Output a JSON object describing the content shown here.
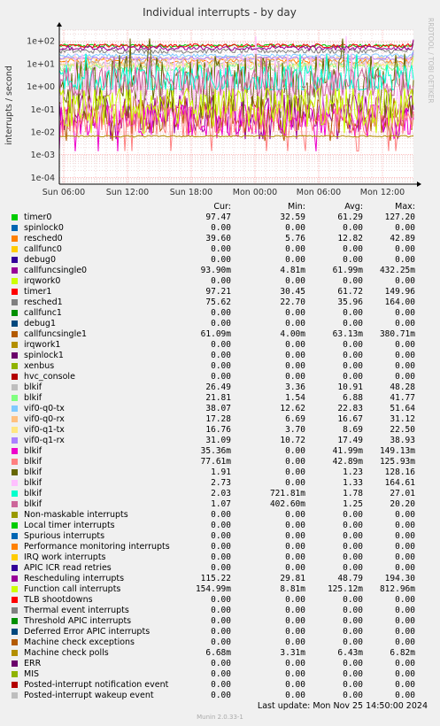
{
  "colors": {
    "background": "#f0f0f0",
    "plot_background": "#ffffff",
    "grid_major": "#ff9999",
    "grid_minor": "#e0b0b0"
  },
  "legend_header": {
    "cur": "Cur:",
    "min": "Min:",
    "avg": "Avg:",
    "max": "Max:"
  },
  "footer": {
    "last_update": "Last update:  Mon Nov 25 14:50:00 2024",
    "munin_version": "Munin 2.0.33-1"
  },
  "chart_data": {
    "type": "line",
    "title": "Individual interrupts - by day",
    "ylabel": "interrupts / second",
    "watermark": "RRDTOOL / TOBI OETIKER",
    "yscale": "log",
    "ylim": [
      5e-05,
      300
    ],
    "y_ticks": [
      {
        "value": 0.0001,
        "label": "1e-04"
      },
      {
        "value": 0.001,
        "label": "1e-03"
      },
      {
        "value": 0.01,
        "label": "1e-02"
      },
      {
        "value": 0.1,
        "label": "1e-01"
      },
      {
        "value": 1,
        "label": "1e+00"
      },
      {
        "value": 10,
        "label": "1e+01"
      },
      {
        "value": 100,
        "label": "1e+02"
      }
    ],
    "x_ticks": [
      "Sun 06:00",
      "Sun 12:00",
      "Sun 18:00",
      "Mon 00:00",
      "Mon 06:00",
      "Mon 12:00"
    ],
    "grid": true,
    "series": [
      {
        "name": "timer0",
        "color": "#00cc00",
        "cur": "97.47",
        "min": "32.59",
        "avg": "61.29",
        "max": "127.20"
      },
      {
        "name": "spinlock0",
        "color": "#0066b3",
        "cur": "0.00",
        "min": "0.00",
        "avg": "0.00",
        "max": "0.00"
      },
      {
        "name": "resched0",
        "color": "#ff8000",
        "cur": "39.60",
        "min": "5.76",
        "avg": "12.82",
        "max": "42.89"
      },
      {
        "name": "callfunc0",
        "color": "#ffcc00",
        "cur": "0.00",
        "min": "0.00",
        "avg": "0.00",
        "max": "0.00"
      },
      {
        "name": "debug0",
        "color": "#330099",
        "cur": "0.00",
        "min": "0.00",
        "avg": "0.00",
        "max": "0.00"
      },
      {
        "name": "callfuncsingle0",
        "color": "#990099",
        "cur": "93.90m",
        "min": "4.81m",
        "avg": "61.99m",
        "max": "432.25m"
      },
      {
        "name": "irqwork0",
        "color": "#ccff00",
        "cur": "0.00",
        "min": "0.00",
        "avg": "0.00",
        "max": "0.00"
      },
      {
        "name": "timer1",
        "color": "#ff0000",
        "cur": "97.21",
        "min": "30.45",
        "avg": "61.72",
        "max": "149.96"
      },
      {
        "name": "resched1",
        "color": "#808080",
        "cur": "75.62",
        "min": "22.70",
        "avg": "35.96",
        "max": "164.00"
      },
      {
        "name": "callfunc1",
        "color": "#008f00",
        "cur": "0.00",
        "min": "0.00",
        "avg": "0.00",
        "max": "0.00"
      },
      {
        "name": "debug1",
        "color": "#00487d",
        "cur": "0.00",
        "min": "0.00",
        "avg": "0.00",
        "max": "0.00"
      },
      {
        "name": "callfuncsingle1",
        "color": "#b35a00",
        "cur": "61.09m",
        "min": "4.00m",
        "avg": "63.13m",
        "max": "380.71m"
      },
      {
        "name": "irqwork1",
        "color": "#b38f00",
        "cur": "0.00",
        "min": "0.00",
        "avg": "0.00",
        "max": "0.00"
      },
      {
        "name": "spinlock1",
        "color": "#6b006b",
        "cur": "0.00",
        "min": "0.00",
        "avg": "0.00",
        "max": "0.00"
      },
      {
        "name": "xenbus",
        "color": "#8fb300",
        "cur": "0.00",
        "min": "0.00",
        "avg": "0.00",
        "max": "0.00"
      },
      {
        "name": "hvc_console",
        "color": "#b30000",
        "cur": "0.00",
        "min": "0.00",
        "avg": "0.00",
        "max": "0.00"
      },
      {
        "name": "blkif",
        "color": "#bebebe",
        "cur": "26.49",
        "min": "3.36",
        "avg": "10.91",
        "max": "48.28"
      },
      {
        "name": "blkif",
        "color": "#80ff80",
        "cur": "21.81",
        "min": "1.54",
        "avg": "6.88",
        "max": "41.77"
      },
      {
        "name": "vif0-q0-tx",
        "color": "#80c9ff",
        "cur": "38.07",
        "min": "12.62",
        "avg": "22.83",
        "max": "51.64"
      },
      {
        "name": "vif0-q0-rx",
        "color": "#ffc080",
        "cur": "17.28",
        "min": "6.69",
        "avg": "16.67",
        "max": "31.12"
      },
      {
        "name": "vif0-q1-tx",
        "color": "#ffe680",
        "cur": "16.76",
        "min": "3.70",
        "avg": "8.69",
        "max": "22.50"
      },
      {
        "name": "vif0-q1-rx",
        "color": "#aa80ff",
        "cur": "31.09",
        "min": "10.72",
        "avg": "17.49",
        "max": "38.93"
      },
      {
        "name": "blkif",
        "color": "#ee00cc",
        "cur": "35.36m",
        "min": "0.00",
        "avg": "41.99m",
        "max": "149.13m"
      },
      {
        "name": "blkif",
        "color": "#ff8080",
        "cur": "77.61m",
        "min": "0.00",
        "avg": "42.89m",
        "max": "125.93m"
      },
      {
        "name": "blkif",
        "color": "#666600",
        "cur": "1.91",
        "min": "0.00",
        "avg": "1.23",
        "max": "128.16"
      },
      {
        "name": "blkif",
        "color": "#ffbfff",
        "cur": "2.73",
        "min": "0.00",
        "avg": "1.33",
        "max": "164.61"
      },
      {
        "name": "blkif",
        "color": "#00ffcc",
        "cur": "2.03",
        "min": "721.81m",
        "avg": "1.78",
        "max": "27.01"
      },
      {
        "name": "blkif",
        "color": "#cc6699",
        "cur": "1.07",
        "min": "402.60m",
        "avg": "1.25",
        "max": "20.20"
      },
      {
        "name": "Non-maskable interrupts",
        "color": "#999900",
        "cur": "0.00",
        "min": "0.00",
        "avg": "0.00",
        "max": "0.00"
      },
      {
        "name": "Local timer interrupts",
        "color": "#00cc00",
        "cur": "0.00",
        "min": "0.00",
        "avg": "0.00",
        "max": "0.00"
      },
      {
        "name": "Spurious interrupts",
        "color": "#0066b3",
        "cur": "0.00",
        "min": "0.00",
        "avg": "0.00",
        "max": "0.00"
      },
      {
        "name": "Performance monitoring interrupts",
        "color": "#ff8000",
        "cur": "0.00",
        "min": "0.00",
        "avg": "0.00",
        "max": "0.00"
      },
      {
        "name": "IRQ work interrupts",
        "color": "#ffcc00",
        "cur": "0.00",
        "min": "0.00",
        "avg": "0.00",
        "max": "0.00"
      },
      {
        "name": "APIC ICR read retries",
        "color": "#330099",
        "cur": "0.00",
        "min": "0.00",
        "avg": "0.00",
        "max": "0.00"
      },
      {
        "name": "Rescheduling interrupts",
        "color": "#990099",
        "cur": "115.22",
        "min": "29.81",
        "avg": "48.79",
        "max": "194.30"
      },
      {
        "name": "Function call interrupts",
        "color": "#ccff00",
        "cur": "154.99m",
        "min": "8.81m",
        "avg": "125.12m",
        "max": "812.96m"
      },
      {
        "name": "TLB shootdowns",
        "color": "#ff0000",
        "cur": "0.00",
        "min": "0.00",
        "avg": "0.00",
        "max": "0.00"
      },
      {
        "name": "Thermal event interrupts",
        "color": "#808080",
        "cur": "0.00",
        "min": "0.00",
        "avg": "0.00",
        "max": "0.00"
      },
      {
        "name": "Threshold APIC interrupts",
        "color": "#008f00",
        "cur": "0.00",
        "min": "0.00",
        "avg": "0.00",
        "max": "0.00"
      },
      {
        "name": "Deferred Error APIC interrupts",
        "color": "#00487d",
        "cur": "0.00",
        "min": "0.00",
        "avg": "0.00",
        "max": "0.00"
      },
      {
        "name": "Machine check exceptions",
        "color": "#b35a00",
        "cur": "0.00",
        "min": "0.00",
        "avg": "0.00",
        "max": "0.00"
      },
      {
        "name": "Machine check polls",
        "color": "#b38f00",
        "cur": "6.68m",
        "min": "3.31m",
        "avg": "6.43m",
        "max": "6.82m"
      },
      {
        "name": "ERR",
        "color": "#6b006b",
        "cur": "0.00",
        "min": "0.00",
        "avg": "0.00",
        "max": "0.00"
      },
      {
        "name": "MIS",
        "color": "#8fb300",
        "cur": "0.00",
        "min": "0.00",
        "avg": "0.00",
        "max": "0.00"
      },
      {
        "name": "Posted-interrupt notification event",
        "color": "#b30000",
        "cur": "0.00",
        "min": "0.00",
        "avg": "0.00",
        "max": "0.00"
      },
      {
        "name": "Posted-interrupt wakeup event",
        "color": "#bebebe",
        "cur": "0.00",
        "min": "0.00",
        "avg": "0.00",
        "max": "0.00"
      }
    ]
  }
}
